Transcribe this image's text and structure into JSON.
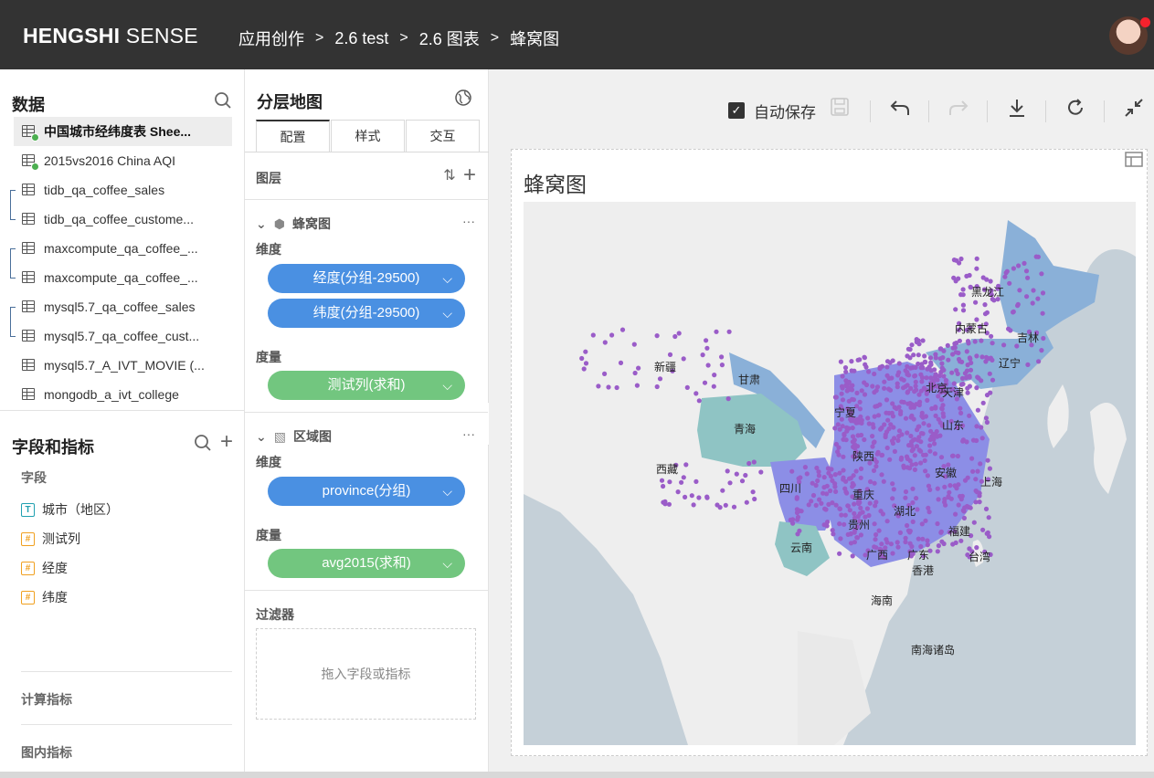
{
  "header": {
    "brand_bold": "HENGSHI",
    "brand_rest": " SENSE",
    "breadcrumb": [
      "应用创作",
      "2.6 test",
      "2.6 图表",
      "蜂窝图"
    ]
  },
  "data_panel": {
    "title": "数据",
    "datasets": [
      {
        "label": "中国城市经纬度表 Shee...",
        "active": true,
        "ok": true
      },
      {
        "label": "2015vs2016 China AQI",
        "active": false,
        "ok": true
      },
      {
        "label": "tidb_qa_coffee_sales",
        "active": false,
        "ok": false
      },
      {
        "label": "tidb_qa_coffee_custome...",
        "active": false,
        "ok": false
      },
      {
        "label": "maxcompute_qa_coffee_...",
        "active": false,
        "ok": false
      },
      {
        "label": "maxcompute_qa_coffee_...",
        "active": false,
        "ok": false
      },
      {
        "label": "mysql5.7_qa_coffee_sales",
        "active": false,
        "ok": false
      },
      {
        "label": "mysql5.7_qa_coffee_cust...",
        "active": false,
        "ok": false
      },
      {
        "label": "mysql5.7_A_IVT_MOVIE (...",
        "active": false,
        "ok": false
      },
      {
        "label": "mongodb_a_ivt_college",
        "active": false,
        "ok": false
      }
    ]
  },
  "fields_panel": {
    "title": "字段和指标",
    "fields_label": "字段",
    "fields": [
      {
        "type": "T",
        "label": "城市（地区）"
      },
      {
        "type": "#",
        "label": "测试列"
      },
      {
        "type": "#",
        "label": "经度"
      },
      {
        "type": "#",
        "label": "纬度"
      }
    ],
    "calc_label": "计算指标",
    "inchart_label": "图内指标"
  },
  "config_panel": {
    "title": "分层地图",
    "tabs": [
      "配置",
      "样式",
      "交互"
    ],
    "layers_label": "图层",
    "layer1": {
      "name": "蜂窝图",
      "dim_label": "维度",
      "dims": [
        "经度(分组-29500)",
        "纬度(分组-29500)"
      ],
      "measure_label": "度量",
      "measures": [
        "测试列(求和)"
      ]
    },
    "layer2": {
      "name": "区域图",
      "dim_label": "维度",
      "dims": [
        "province(分组)"
      ],
      "measure_label": "度量",
      "measures": [
        "avg2015(求和)"
      ]
    },
    "filter_label": "过滤器",
    "filter_placeholder": "拖入字段或指标"
  },
  "toolbar": {
    "autosave_label": "自动保存",
    "autosave_checked": true
  },
  "chart": {
    "title": "蜂窝图",
    "map_labels": [
      "黑龙江",
      "吉林",
      "内蒙古",
      "辽宁",
      "新疆",
      "甘肃",
      "北京",
      "天津",
      "宁夏",
      "山东",
      "青海",
      "陕西",
      "西藏",
      "四川",
      "安徽",
      "上海",
      "湖北",
      "重庆",
      "贵州",
      "云南",
      "广西",
      "福建",
      "广东",
      "香港",
      "台湾",
      "海南",
      "南海诸岛"
    ],
    "colors": {
      "sea": "#c5d0d8",
      "land": "#eeeeee",
      "province_blue": "#8ab0d8",
      "province_teal": "#8fc4c4",
      "province_violet": "#8c8ee6",
      "hex_purple": "#9a5cc8"
    }
  }
}
